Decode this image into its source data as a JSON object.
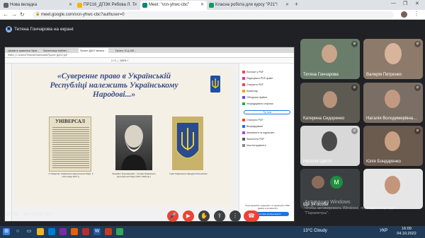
{
  "browser": {
    "tabs": [
      {
        "label": "Нова вкладка",
        "color": "#5f6368"
      },
      {
        "label": "ПР216_ДПЭК Рябова Л. Т.",
        "color": "#f4b400"
      },
      {
        "label": "Meet: \"vcn-yhwc-cbc\"",
        "color": "#00897b"
      },
      {
        "label": "Класна робота для курсу \"Р21\"!",
        "color": "#0f9d58"
      }
    ],
    "url": "meet.google.com/vcn-yhwc-cbc?authuser=0"
  },
  "meet": {
    "presenting_banner": "Тетяна Гончарова на екрані",
    "time": "16:09",
    "meeting_code": "vcn-yhwc-cbc",
    "others_count": "Ще 34 особи",
    "others_initial": "M",
    "participants": [
      {
        "name": "Тетяна Гончарова"
      },
      {
        "name": "Валерія Петренко"
      },
      {
        "name": "Катерина Сидоренко"
      },
      {
        "name": "Наталія Володимирівна..."
      },
      {
        "name": "Наталія Цветік"
      },
      {
        "name": "Юлія Бондаренко"
      }
    ]
  },
  "shared_screen": {
    "inner_tabs": [
      "Цікавість правління Украї...",
      "Презентація Кабінет...",
      "Проект ДАСУ велика ...",
      "Проект 10 д 182..."
    ],
    "inner_url": "Файл | C:/Users/Тетяна/Downloads/Проект ДАСУ.pdf",
    "toolbar": "1 / 1    — 100% +",
    "slide_title": "«Суверенне право в Українській Республіці належить Українському Народові...»",
    "newspaper_title": "УНІВЕРСАЛ",
    "captions": [
      "ІІ Універсал Української Центральної Ради. 3 листопада 1917 р.",
      "Михайло Грушевський – Голова Української Центральної Ради (1917-1918 рр.)",
      "Герб Української Народної Республіки"
    ],
    "tools": [
      "Експорт у PDF",
      "Редагувати PDF-файл",
      "Створити PDF",
      "Коментар",
      "Об'єднати файли",
      "Упорядкувати сторінки",
      "Стиснути PDF",
      "Впорядкувати",
      "Заповнити та підписати",
      "Захистити PDF",
      "Інші інструменти"
    ],
    "try_label": "Try now",
    "promo_text": "Перетворюйте, редагуйте та підписуйте PDF-файли в Acrobat Pro",
    "promo_btn": "Безкоштовна пробна версія"
  },
  "watermark": {
    "line1": "Активация Windows",
    "line2": "Чтобы активировать Windows, перейдите в раздел",
    "line3": "\"Параметры\"."
  },
  "taskbar": {
    "weather": "13°C  Cloudy",
    "lang": "УКР",
    "time": "16:09",
    "date": "04.10.2022"
  },
  "colors": {
    "meet_bg": "#202124",
    "hangup": "#ea4335",
    "accent": "#8ab4f8"
  }
}
